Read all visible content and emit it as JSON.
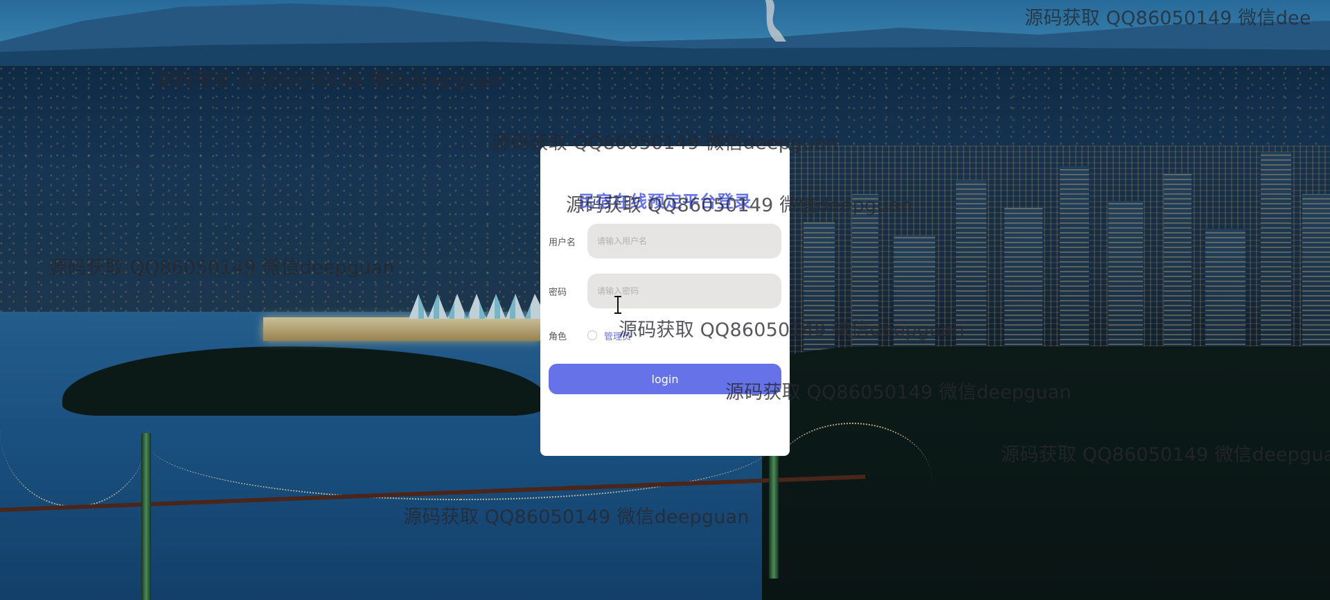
{
  "login": {
    "title": "民宿在线预定平台登录",
    "username_label": "用户名",
    "username_placeholder": "请输入用户名",
    "password_label": "密码",
    "password_placeholder": "请输入密码",
    "role_label": "角色",
    "role_option": "管理员",
    "submit_label": "login"
  },
  "watermark": {
    "text": "源码获取 QQ86050149 微信deepguan",
    "text_cut": "源码获取 QQ86050149 微信dee"
  },
  "colors": {
    "accent": "#6673e8",
    "input_bg": "#e7e4e4",
    "card_bg": "#ffffff"
  }
}
